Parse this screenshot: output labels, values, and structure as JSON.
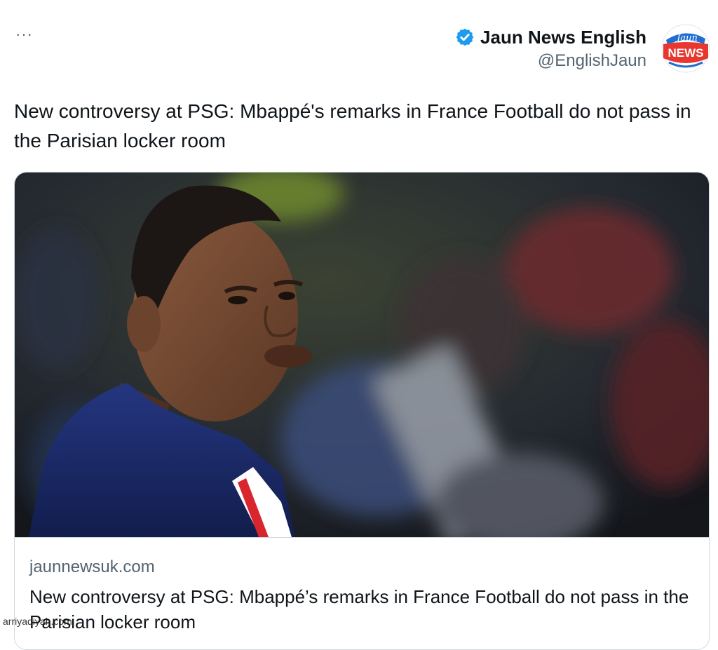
{
  "header": {
    "more_label": "···",
    "display_name": "Jaun News English",
    "handle": "@EnglishJaun",
    "verified_icon": "verified-badge-icon",
    "avatar_logo_top": "Jaun",
    "avatar_logo_bottom": "NEWS"
  },
  "tweet": {
    "text": "New controversy at PSG: Mbappé's remarks in France Football do not pass in the Parisian locker room"
  },
  "card": {
    "image": "photo-of-footballer-in-navy-jersey",
    "domain": "jaunnewsuk.com",
    "title": "New controversy at PSG: Mbappé’s remarks in France Football do not pass in the Parisian locker room"
  },
  "watermark": "arriyadiyah.com",
  "colors": {
    "accent": "#1d9bf0",
    "text_primary": "#0f1419",
    "text_secondary": "#536471",
    "border": "#cfd9de",
    "logo_red": "#e8372e",
    "logo_blue": "#1f6fd1",
    "jersey_navy": "#1b2a66"
  }
}
